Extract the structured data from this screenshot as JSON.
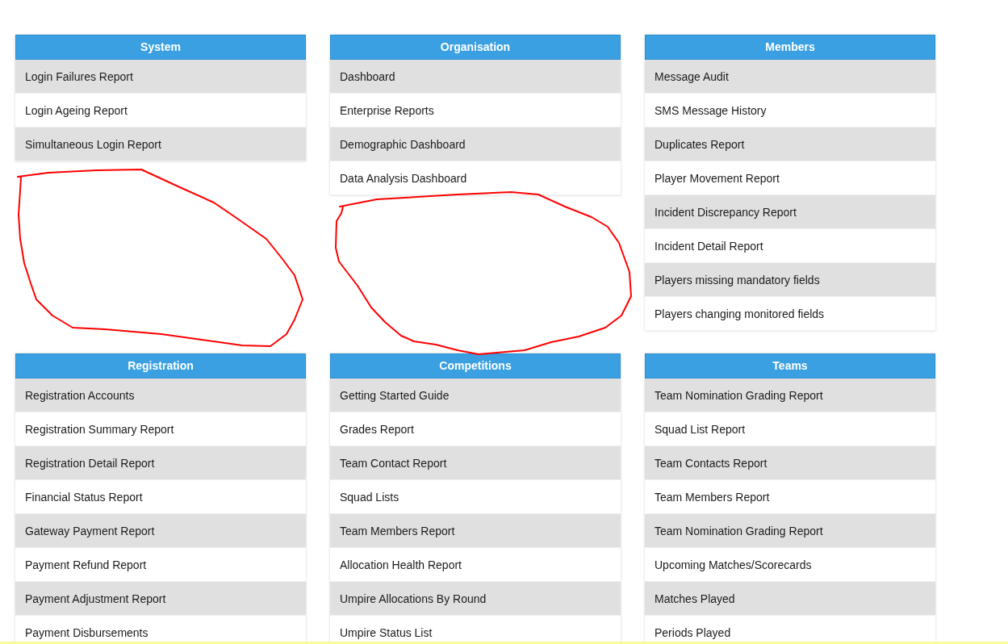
{
  "sections": [
    {
      "title": "System",
      "items": [
        "Login Failures Report",
        "Login Ageing Report",
        "Simultaneous Login Report"
      ]
    },
    {
      "title": "Organisation",
      "items": [
        "Dashboard",
        "Enterprise Reports",
        "Demographic Dashboard",
        "Data Analysis Dashboard"
      ]
    },
    {
      "title": "Members",
      "items": [
        "Message Audit",
        "SMS Message History",
        "Duplicates Report",
        "Player Movement Report",
        "Incident Discrepancy Report",
        "Incident Detail Report",
        "Players missing mandatory fields",
        "Players changing monitored fields"
      ]
    },
    {
      "title": "Registration",
      "items": [
        "Registration Accounts",
        "Registration Summary Report",
        "Registration Detail Report",
        "Financial Status Report",
        "Gateway Payment Report",
        "Payment Refund Report",
        "Payment Adjustment Report",
        "Payment Disbursements"
      ]
    },
    {
      "title": "Competitions",
      "items": [
        "Getting Started Guide",
        "Grades Report",
        "Team Contact Report",
        "Squad Lists",
        "Team Members Report",
        "Allocation Health Report",
        "Umpire Allocations By Round",
        "Umpire Status List"
      ]
    },
    {
      "title": "Teams",
      "items": [
        "Team Nomination Grading Report",
        "Squad List Report",
        "Team Contacts Report",
        "Team Members Report",
        "Team Nomination Grading Report",
        "Upcoming Matches/Scorecards",
        "Matches Played",
        "Periods Played"
      ]
    }
  ]
}
